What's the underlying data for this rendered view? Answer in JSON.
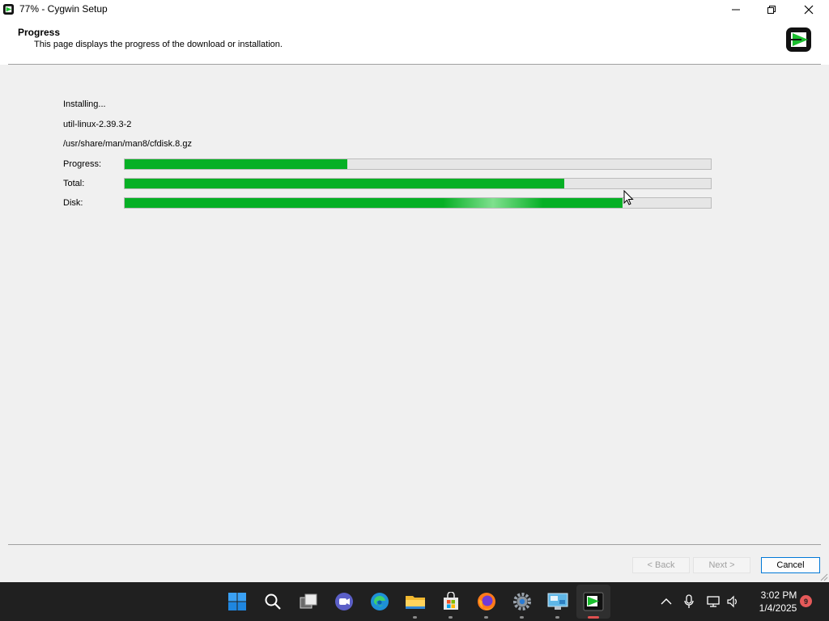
{
  "window": {
    "title": "77% - Cygwin Setup"
  },
  "header": {
    "title": "Progress",
    "subtitle": "This page displays the progress of the download or installation."
  },
  "status": {
    "action": "Installing...",
    "package": "util-linux-2.39.3-2",
    "file": "/usr/share/man/man8/cfdisk.8.gz"
  },
  "bars": [
    {
      "label": "Progress:",
      "fraction": 0.38
    },
    {
      "label": "Total:",
      "fraction": 0.75
    },
    {
      "label": "Disk:",
      "fraction": 0.85
    }
  ],
  "buttons": {
    "back": "< Back",
    "next": "Next >",
    "cancel": "Cancel"
  },
  "taskbar": {
    "time": "3:02 PM",
    "date": "1/4/2025",
    "notification_count": "9",
    "apps": [
      "start-icon",
      "search-icon",
      "task-view-icon",
      "chat-icon",
      "edge-icon",
      "file-explorer-icon",
      "store-icon",
      "firefox-icon",
      "settings-icon",
      "control-panel-icon",
      "cygwin-terminal-icon"
    ]
  },
  "colors": {
    "progress_fill": "#06b025",
    "taskbar_bg": "#202020",
    "cancel_border": "#0078d7"
  }
}
